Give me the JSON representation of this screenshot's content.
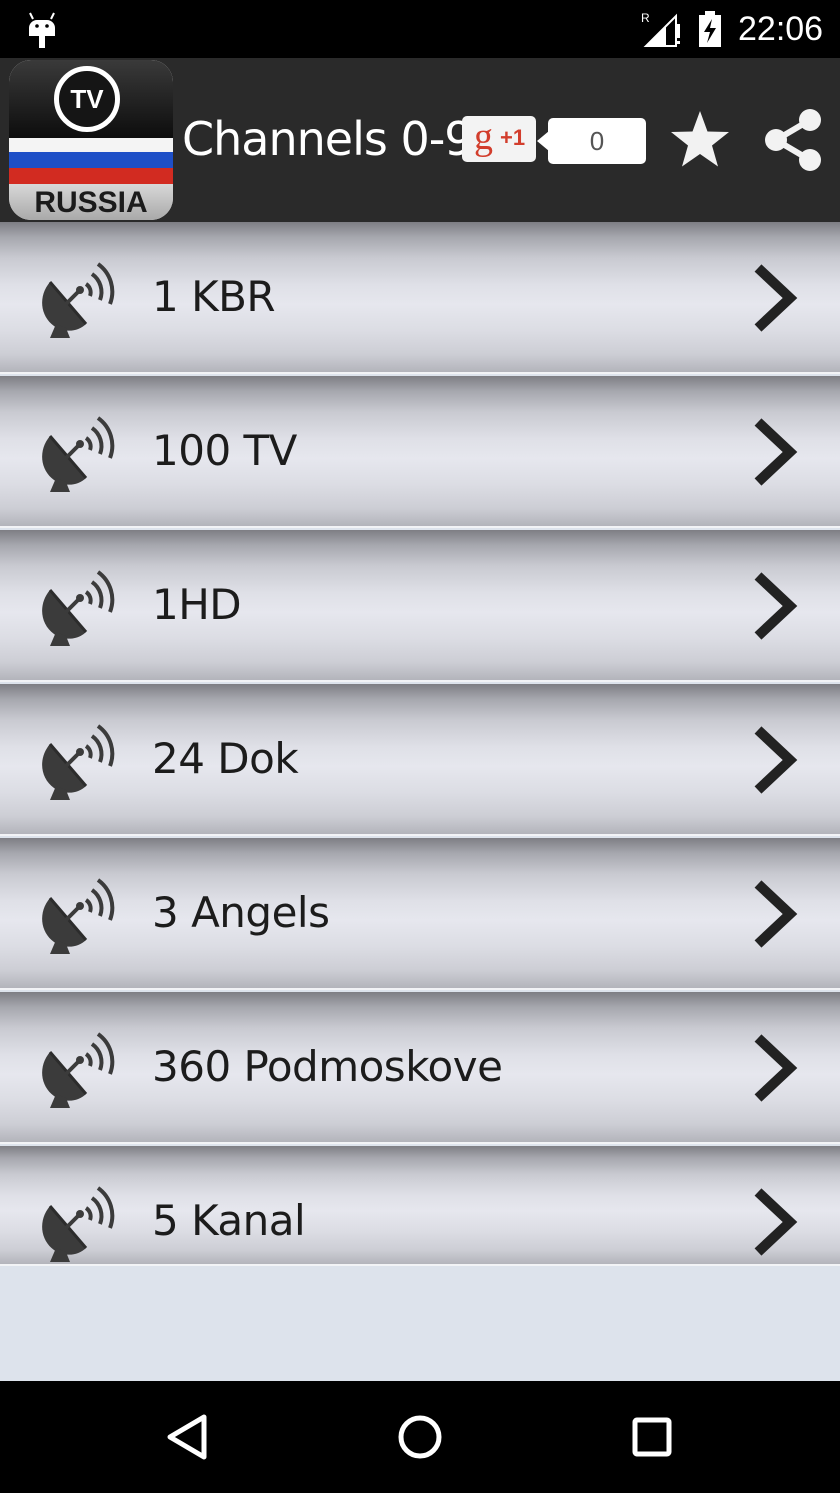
{
  "status_bar": {
    "time": "22:06",
    "signal_label": "R",
    "icons": [
      "android-icon",
      "signal-icon",
      "battery-charging-icon"
    ]
  },
  "app_bar": {
    "logo_badge": "TV",
    "logo_text": "RUSSIA",
    "title": "Channels 0-9",
    "gplus_label": "+1",
    "gplus_count": "0",
    "icons": [
      "star-icon",
      "share-icon"
    ]
  },
  "channels": [
    {
      "name": "1 KBR"
    },
    {
      "name": "100 TV"
    },
    {
      "name": "1HD"
    },
    {
      "name": "24 Dok"
    },
    {
      "name": "3 Angels"
    },
    {
      "name": "360 Podmoskove"
    },
    {
      "name": "5 Kanal"
    }
  ],
  "nav_bar": {
    "icons": [
      "back-icon",
      "home-icon",
      "recents-icon"
    ]
  },
  "colors": {
    "app_bar_bg": "#2a2a2a",
    "list_bg": "#dde3ec",
    "gplus_red": "#d23d2c",
    "flag_blue": "#1e4fc7",
    "flag_red": "#d22b21"
  }
}
